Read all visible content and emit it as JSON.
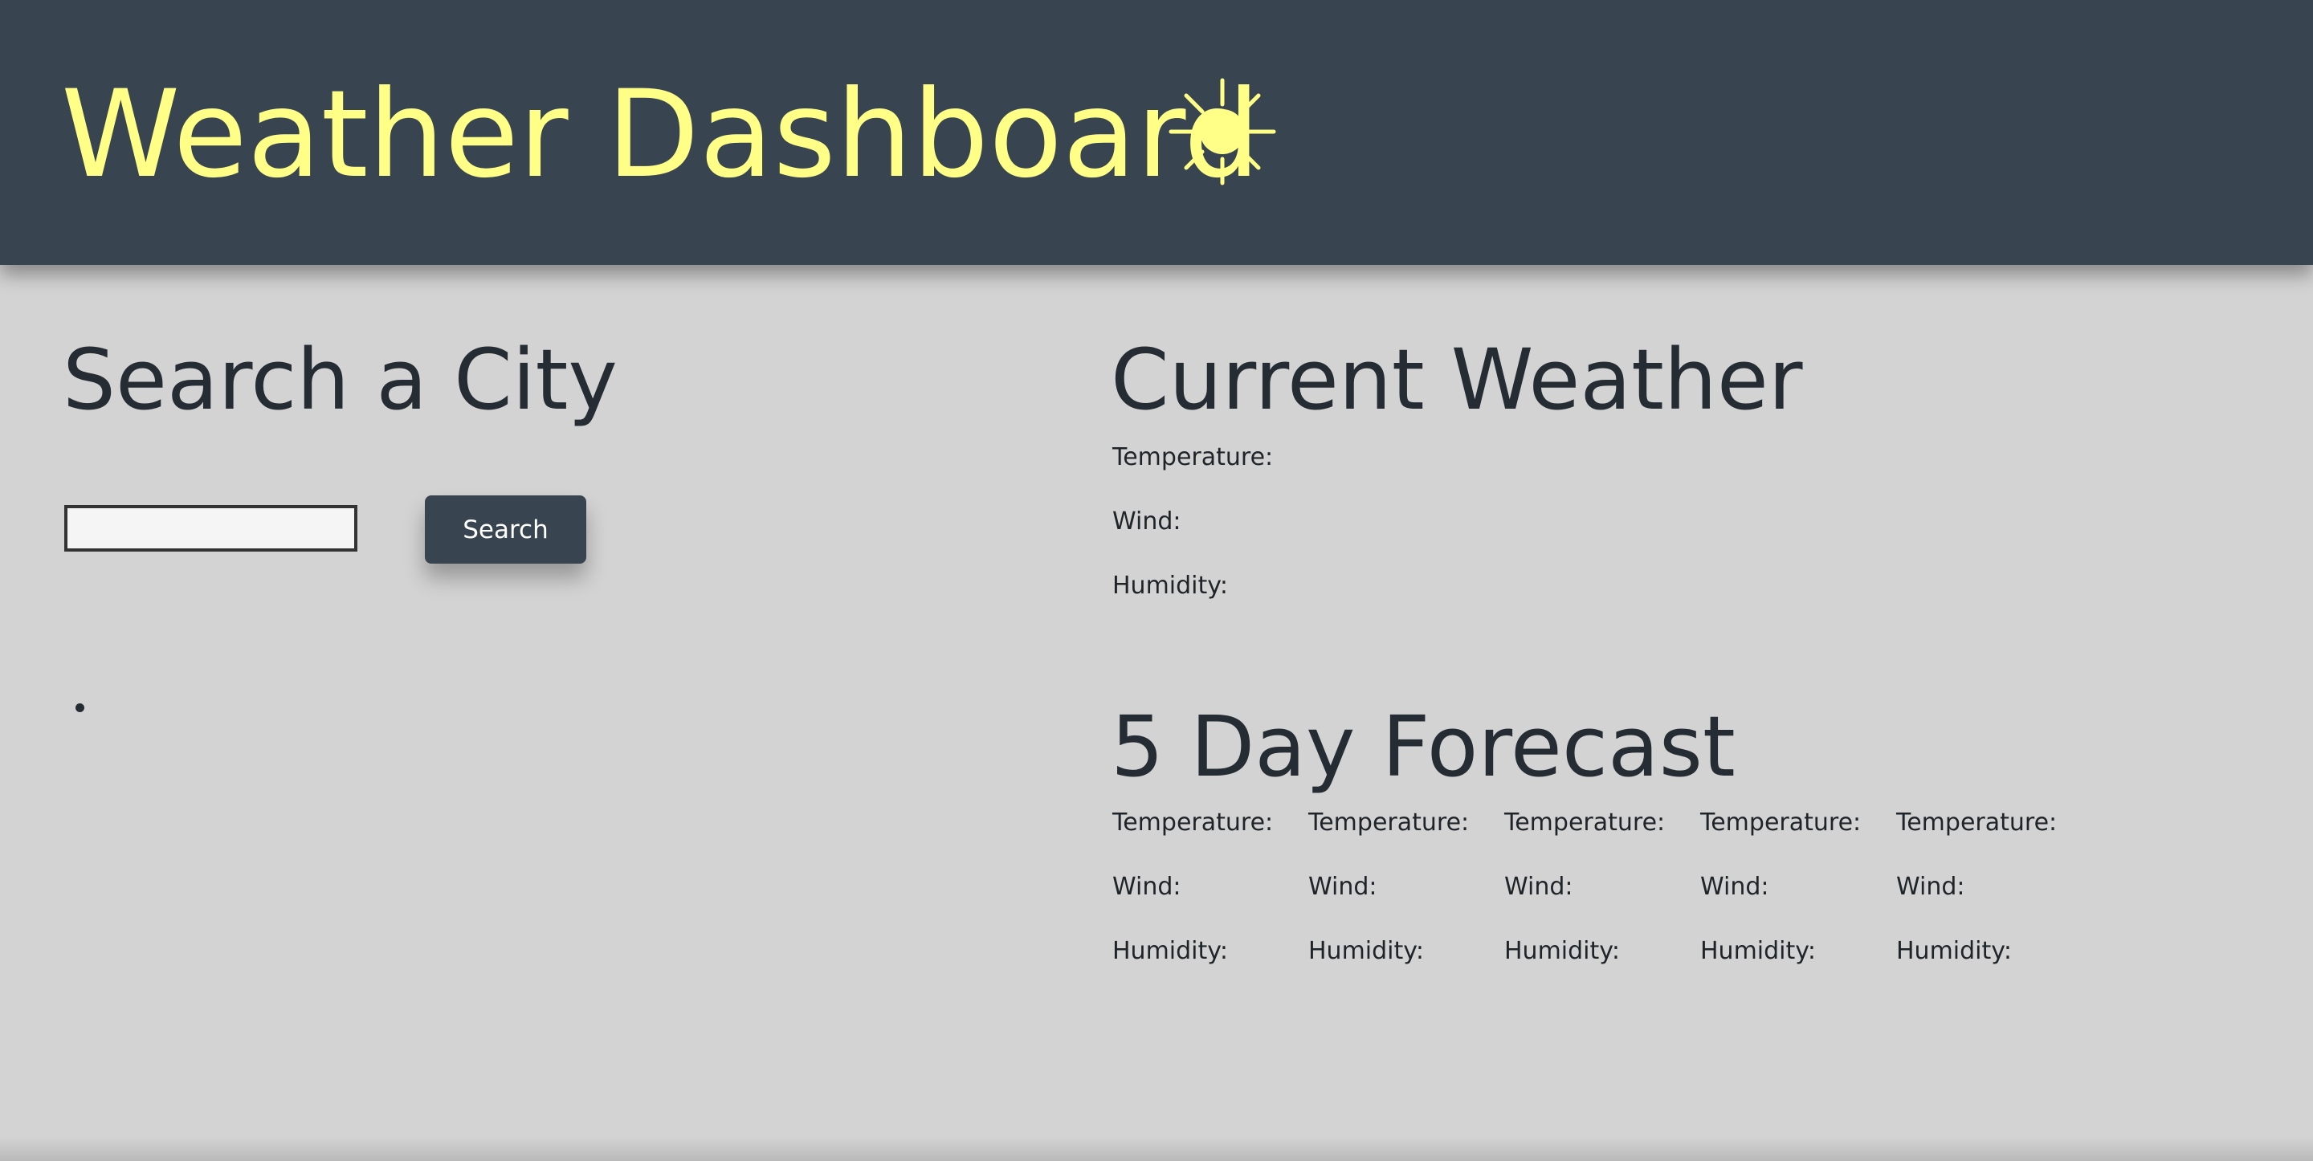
{
  "header": {
    "title": "Weather Dashboard",
    "icon": "sun-icon",
    "title_color": "#ffff88",
    "background": "#38444f"
  },
  "search": {
    "heading": "Search a City",
    "input_value": "",
    "button_label": "Search"
  },
  "history": {
    "items": [
      ""
    ]
  },
  "current": {
    "heading": "Current Weather",
    "temperature_label": "Temperature:",
    "wind_label": "Wind:",
    "humidity_label": "Humidity:"
  },
  "forecast": {
    "heading": "5 Day Forecast",
    "days": [
      {
        "temperature_label": "Temperature:",
        "wind_label": "Wind:",
        "humidity_label": "Humidity:"
      },
      {
        "temperature_label": "Temperature:",
        "wind_label": "Wind:",
        "humidity_label": "Humidity:"
      },
      {
        "temperature_label": "Temperature:",
        "wind_label": "Wind:",
        "humidity_label": "Humidity:"
      },
      {
        "temperature_label": "Temperature:",
        "wind_label": "Wind:",
        "humidity_label": "Humidity:"
      },
      {
        "temperature_label": "Temperature:",
        "wind_label": "Wind:",
        "humidity_label": "Humidity:"
      }
    ]
  },
  "colors": {
    "page_background": "#d3d3d3",
    "heading_text": "#262c33",
    "button_background": "#38444f",
    "button_text": "#ffffff"
  }
}
